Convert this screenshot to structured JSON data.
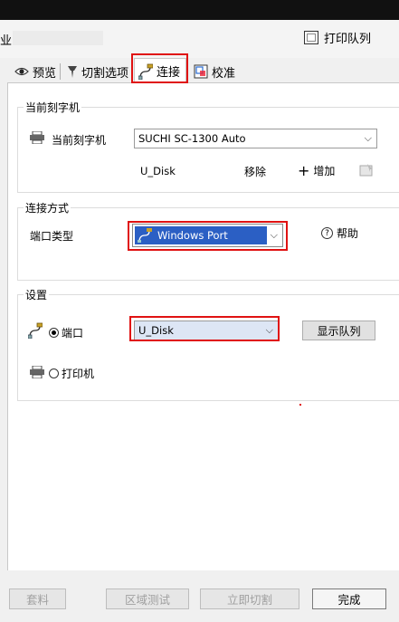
{
  "header": {
    "partial_title": "业",
    "print_queue_label": "打印队列"
  },
  "tabs": [
    {
      "label": "预览",
      "icon": "eye-icon"
    },
    {
      "label": "切割选项",
      "icon": "knife-icon"
    },
    {
      "label": "连接",
      "icon": "plug-icon",
      "selected": true
    },
    {
      "label": "校准",
      "icon": "calibrate-icon"
    }
  ],
  "current_cutter": {
    "group_title": "当前刻字机",
    "label": "当前刻字机",
    "selected_device": "SUCHI SC-1300 Auto",
    "port_name": "U_Disk",
    "remove_label": "移除",
    "add_label": "增加"
  },
  "connection": {
    "group_title": "连接方式",
    "port_type_label": "端口类型",
    "port_type_value": "Windows Port",
    "help_label": "帮助"
  },
  "settings": {
    "group_title": "设置",
    "port_radio_label": "端口",
    "port_value": "U_Disk",
    "show_queue_label": "显示队列",
    "printer_radio_label": "打印机"
  },
  "footer": {
    "buttons": [
      {
        "label": "套料",
        "enabled": false
      },
      {
        "label": "区域测试",
        "enabled": false
      },
      {
        "label": "立即切割",
        "enabled": false
      },
      {
        "label": "完成",
        "enabled": true
      }
    ]
  },
  "colors": {
    "highlight": "#e01212",
    "combo_selected": "#2b5fc4"
  }
}
